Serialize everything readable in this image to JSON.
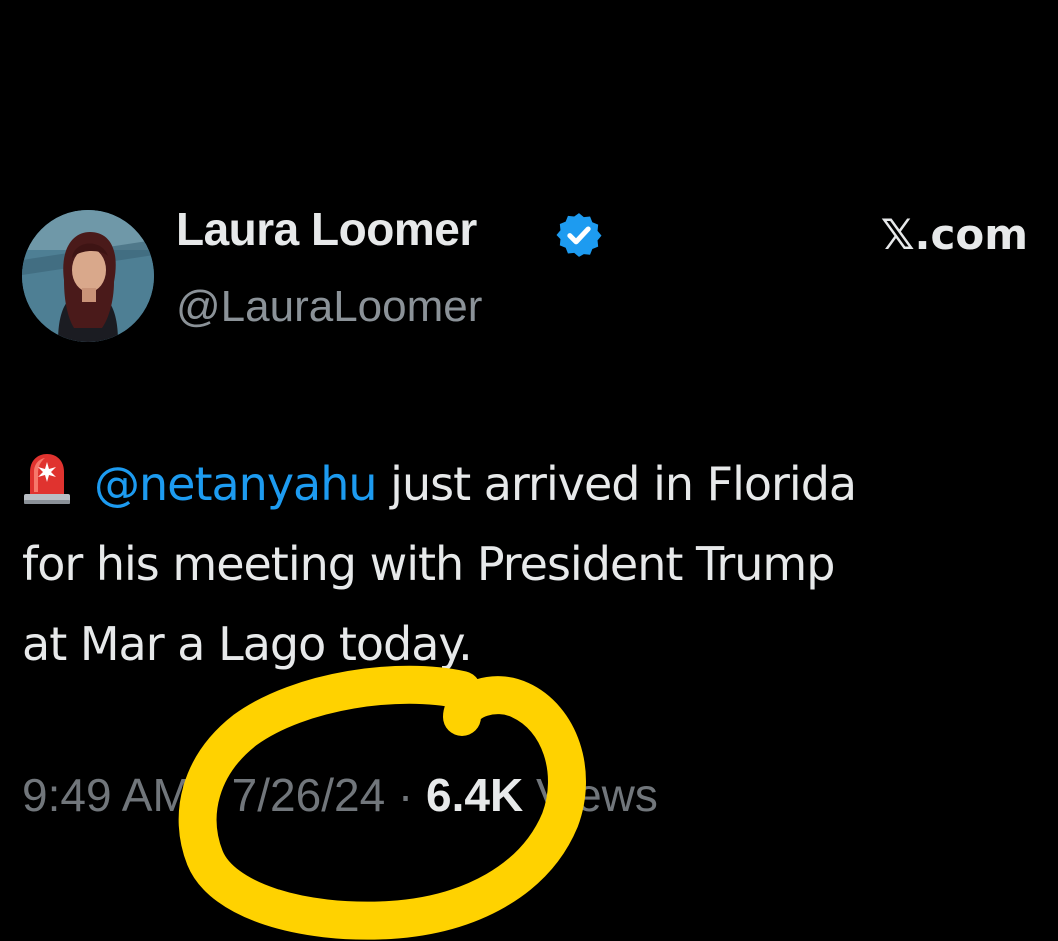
{
  "author": {
    "display_name": "Laura Loomer",
    "handle": "@LauraLoomer",
    "verified": true,
    "avatar_icon": "profile-photo"
  },
  "brand": {
    "label": "𝕏.com"
  },
  "tweet": {
    "emoji_icon": "rotating-light-icon",
    "mention": "@netanyahu",
    "line1_rest": " just arrived in Florida",
    "line2": "for his meeting with President Trump",
    "line3": "at Mar a Lago today."
  },
  "meta": {
    "time": "9:49 AM",
    "separator": " · ",
    "date": "7/26/24",
    "views_count": "6.4K",
    "views_label": " Views"
  },
  "colors": {
    "background": "#000000",
    "text_primary": "#e7e9ea",
    "text_secondary": "#71767b",
    "link": "#1d9bf0",
    "verified_badge": "#1d9bf0",
    "highlight_circle": "#ffd200"
  }
}
